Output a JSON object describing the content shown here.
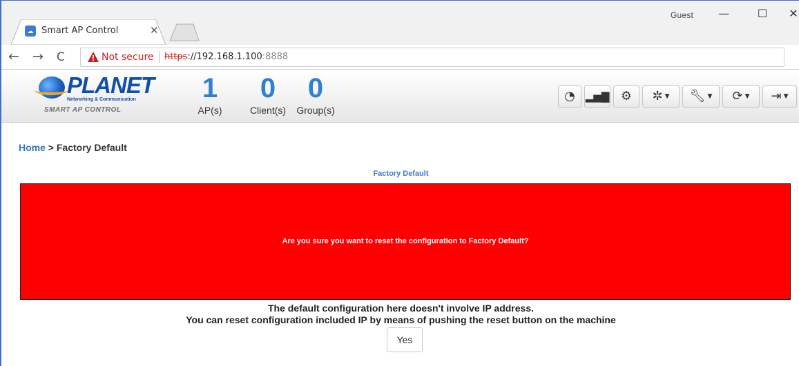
{
  "browser": {
    "tab_title": "Smart AP Control",
    "user_label": "Guest",
    "security_label": "Not secure",
    "url_scheme": "https",
    "url_host": "://192.168.1.100",
    "url_port": ":8888"
  },
  "app": {
    "logo_text": "PLANET",
    "logo_subtext": "Networking & Communication",
    "logo_tagline": "SMART AP CONTROL",
    "stats": [
      {
        "value": "1",
        "label": "AP(s)"
      },
      {
        "value": "0",
        "label": "Client(s)"
      },
      {
        "value": "0",
        "label": "Group(s)"
      }
    ],
    "toolbar_icons": [
      "dashboard-icon",
      "chart-icon",
      "network-icon",
      "gear-icon",
      "wrench-icon",
      "refresh-icon",
      "logout-icon"
    ]
  },
  "breadcrumb": {
    "home": "Home",
    "separator": ">",
    "current": "Factory Default"
  },
  "main": {
    "section_title": "Factory Default",
    "alert_message": "Are you sure you want to reset the configuration to Factory Default?",
    "note_line1": "The default configuration here doesn't involve IP address.",
    "note_line2": "You can reset configuration included IP by means of pushing the reset button on the machine",
    "yes_label": "Yes"
  },
  "colors": {
    "alert_bg": "#ff0000",
    "accent": "#2f7fd3",
    "link": "#2f72c4"
  }
}
